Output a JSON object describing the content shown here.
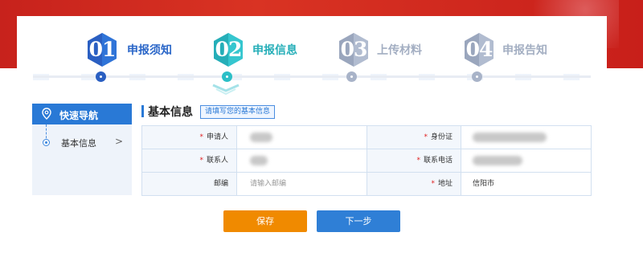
{
  "colors": {
    "banner_red": "#d93323",
    "primary_blue": "#2979d6",
    "teal": "#2bbfc7",
    "inactive": "#a8b3c8",
    "save_orange": "#f08a00"
  },
  "steps": [
    {
      "num": "01",
      "label": "申报须知",
      "state": "done"
    },
    {
      "num": "02",
      "label": "申报信息",
      "state": "active"
    },
    {
      "num": "03",
      "label": "上传材料",
      "state": "pending"
    },
    {
      "num": "04",
      "label": "申报告知",
      "state": "pending"
    }
  ],
  "sidebar": {
    "title": "快速导航",
    "items": [
      {
        "label": "基本信息",
        "arrow": ">"
      }
    ]
  },
  "section": {
    "title": "基本信息",
    "hint": "请填写您的基本信息"
  },
  "form": {
    "required_mark": "*",
    "applicant_label": "申请人",
    "id_card_label": "身份证",
    "contact_label": "联系人",
    "phone_label": "联系电话",
    "postcode_label": "邮编",
    "postcode_placeholder": "请输入邮编",
    "address_label": "地址",
    "address_value": "信阳市"
  },
  "buttons": {
    "save": "保存",
    "next": "下一步"
  }
}
